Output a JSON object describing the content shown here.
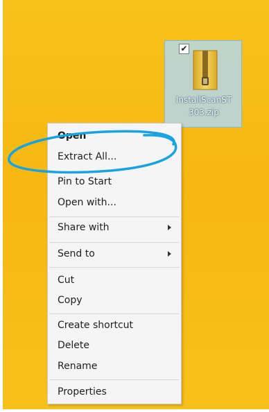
{
  "file": {
    "name_line1": "InstallScanST",
    "name_line2": "303.zip",
    "checkbox_mark": "✔"
  },
  "menu": {
    "items": [
      {
        "label": "Open"
      },
      {
        "label": "Extract All..."
      },
      {
        "label": "Pin to Start"
      },
      {
        "label": "Open with..."
      },
      {
        "label": "Share with"
      },
      {
        "label": "Send to"
      },
      {
        "label": "Cut"
      },
      {
        "label": "Copy"
      },
      {
        "label": "Create shortcut"
      },
      {
        "label": "Delete"
      },
      {
        "label": "Rename"
      },
      {
        "label": "Properties"
      }
    ]
  },
  "icons": {
    "file": "zip-folder-icon",
    "submenu": "chevron-right-icon"
  },
  "colors": {
    "desktop": "#f8c21a",
    "selection": "#b4d7eb",
    "annotation": "#1aa3e0"
  }
}
